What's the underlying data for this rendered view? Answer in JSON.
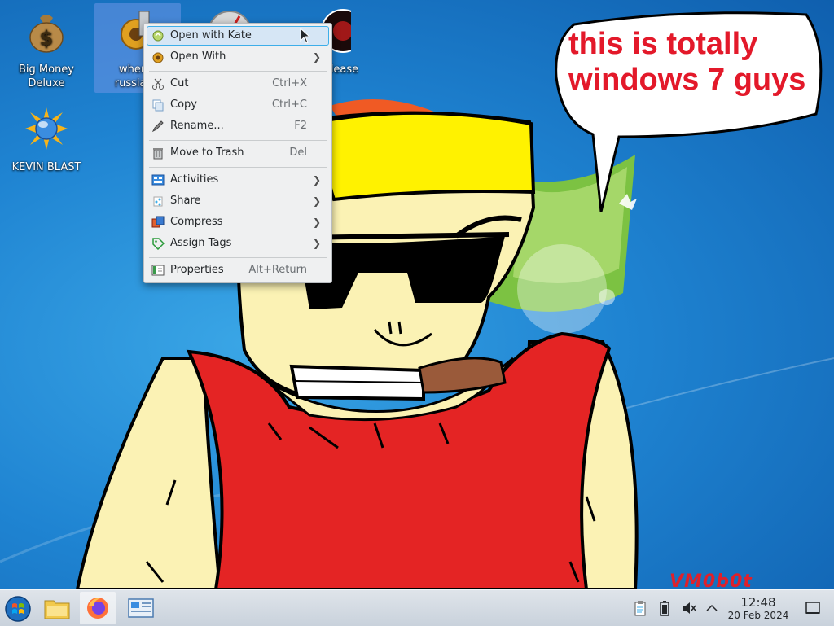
{
  "desktop": {
    "icons": [
      {
        "label_line1": "Big Money",
        "label_line2": "Deluxe",
        "icon": "money-bag-icon"
      },
      {
        "label_line1": "when s",
        "label_line2": "russian r",
        "icon": "gear-app-icon"
      },
      {
        "label_line1": "KEVIN BLAST",
        "label_line2": "",
        "icon": "kevin-blast-icon"
      },
      {
        "label_line1": "lease",
        "label_line2": "",
        "icon": "dark-disc-icon"
      }
    ]
  },
  "wallpaper": {
    "speech_line1": "this is totally",
    "speech_line2": "windows 7 guys",
    "watermark": "VM0b0t"
  },
  "context_menu": {
    "items": [
      {
        "label": "Open with Kate",
        "shortcut": "",
        "submenu": false,
        "icon": "kate-icon",
        "highlighted": true
      },
      {
        "label": "Open With",
        "shortcut": "",
        "submenu": true,
        "icon": "open-with-icon"
      },
      {
        "label": "Cut",
        "shortcut": "Ctrl+X",
        "submenu": false,
        "icon": "cut-icon"
      },
      {
        "label": "Copy",
        "shortcut": "Ctrl+C",
        "submenu": false,
        "icon": "copy-icon"
      },
      {
        "label": "Rename...",
        "shortcut": "F2",
        "submenu": false,
        "icon": "rename-icon"
      },
      {
        "label": "Move to Trash",
        "shortcut": "Del",
        "submenu": false,
        "icon": "trash-icon"
      },
      {
        "label": "Activities",
        "shortcut": "",
        "submenu": true,
        "icon": "activities-icon"
      },
      {
        "label": "Share",
        "shortcut": "",
        "submenu": true,
        "icon": "share-icon"
      },
      {
        "label": "Compress",
        "shortcut": "",
        "submenu": true,
        "icon": "compress-icon"
      },
      {
        "label": "Assign Tags",
        "shortcut": "",
        "submenu": true,
        "icon": "tag-icon"
      },
      {
        "label": "Properties",
        "shortcut": "Alt+Return",
        "submenu": false,
        "icon": "properties-icon"
      }
    ]
  },
  "taskbar": {
    "start_icon": "windows-orb-icon",
    "pinned": [
      "file-manager-icon",
      "firefox-icon",
      "system-settings-icon"
    ],
    "tray": [
      "clipboard-icon",
      "battery-icon",
      "volume-muted-icon",
      "chevron-up-icon"
    ],
    "clock": {
      "time": "12:48",
      "date": "20 Feb 2024"
    },
    "show_desktop_icon": "show-desktop-icon"
  },
  "colors": {
    "accent": "#3daee9",
    "menu_bg": "#eff0f1",
    "speech_text": "#e3192a",
    "desktop_blue": "#1f84d2"
  }
}
